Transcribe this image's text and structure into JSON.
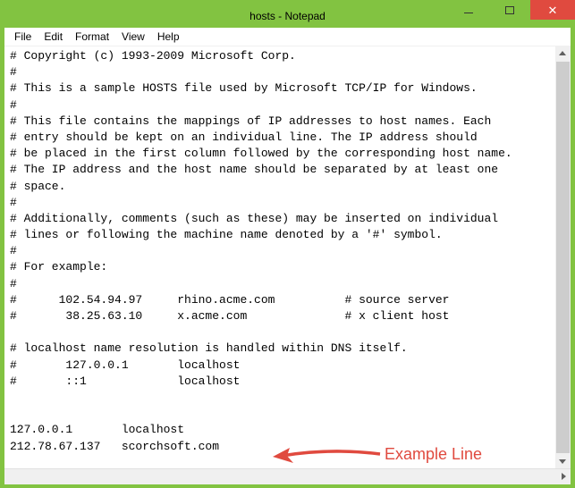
{
  "window": {
    "title": "hosts - Notepad"
  },
  "menu": {
    "items": [
      "File",
      "Edit",
      "Format",
      "View",
      "Help"
    ]
  },
  "editor": {
    "content": "# Copyright (c) 1993-2009 Microsoft Corp.\n#\n# This is a sample HOSTS file used by Microsoft TCP/IP for Windows.\n#\n# This file contains the mappings of IP addresses to host names. Each\n# entry should be kept on an individual line. The IP address should\n# be placed in the first column followed by the corresponding host name.\n# The IP address and the host name should be separated by at least one\n# space.\n#\n# Additionally, comments (such as these) may be inserted on individual\n# lines or following the machine name denoted by a '#' symbol.\n#\n# For example:\n#\n#      102.54.94.97     rhino.acme.com          # source server\n#       38.25.63.10     x.acme.com              # x client host\n\n# localhost name resolution is handled within DNS itself.\n#       127.0.0.1       localhost\n#       ::1             localhost\n\n\n127.0.0.1       localhost\n212.78.67.137   scorchsoft.com"
  },
  "annotation": {
    "label": "Example Line"
  }
}
